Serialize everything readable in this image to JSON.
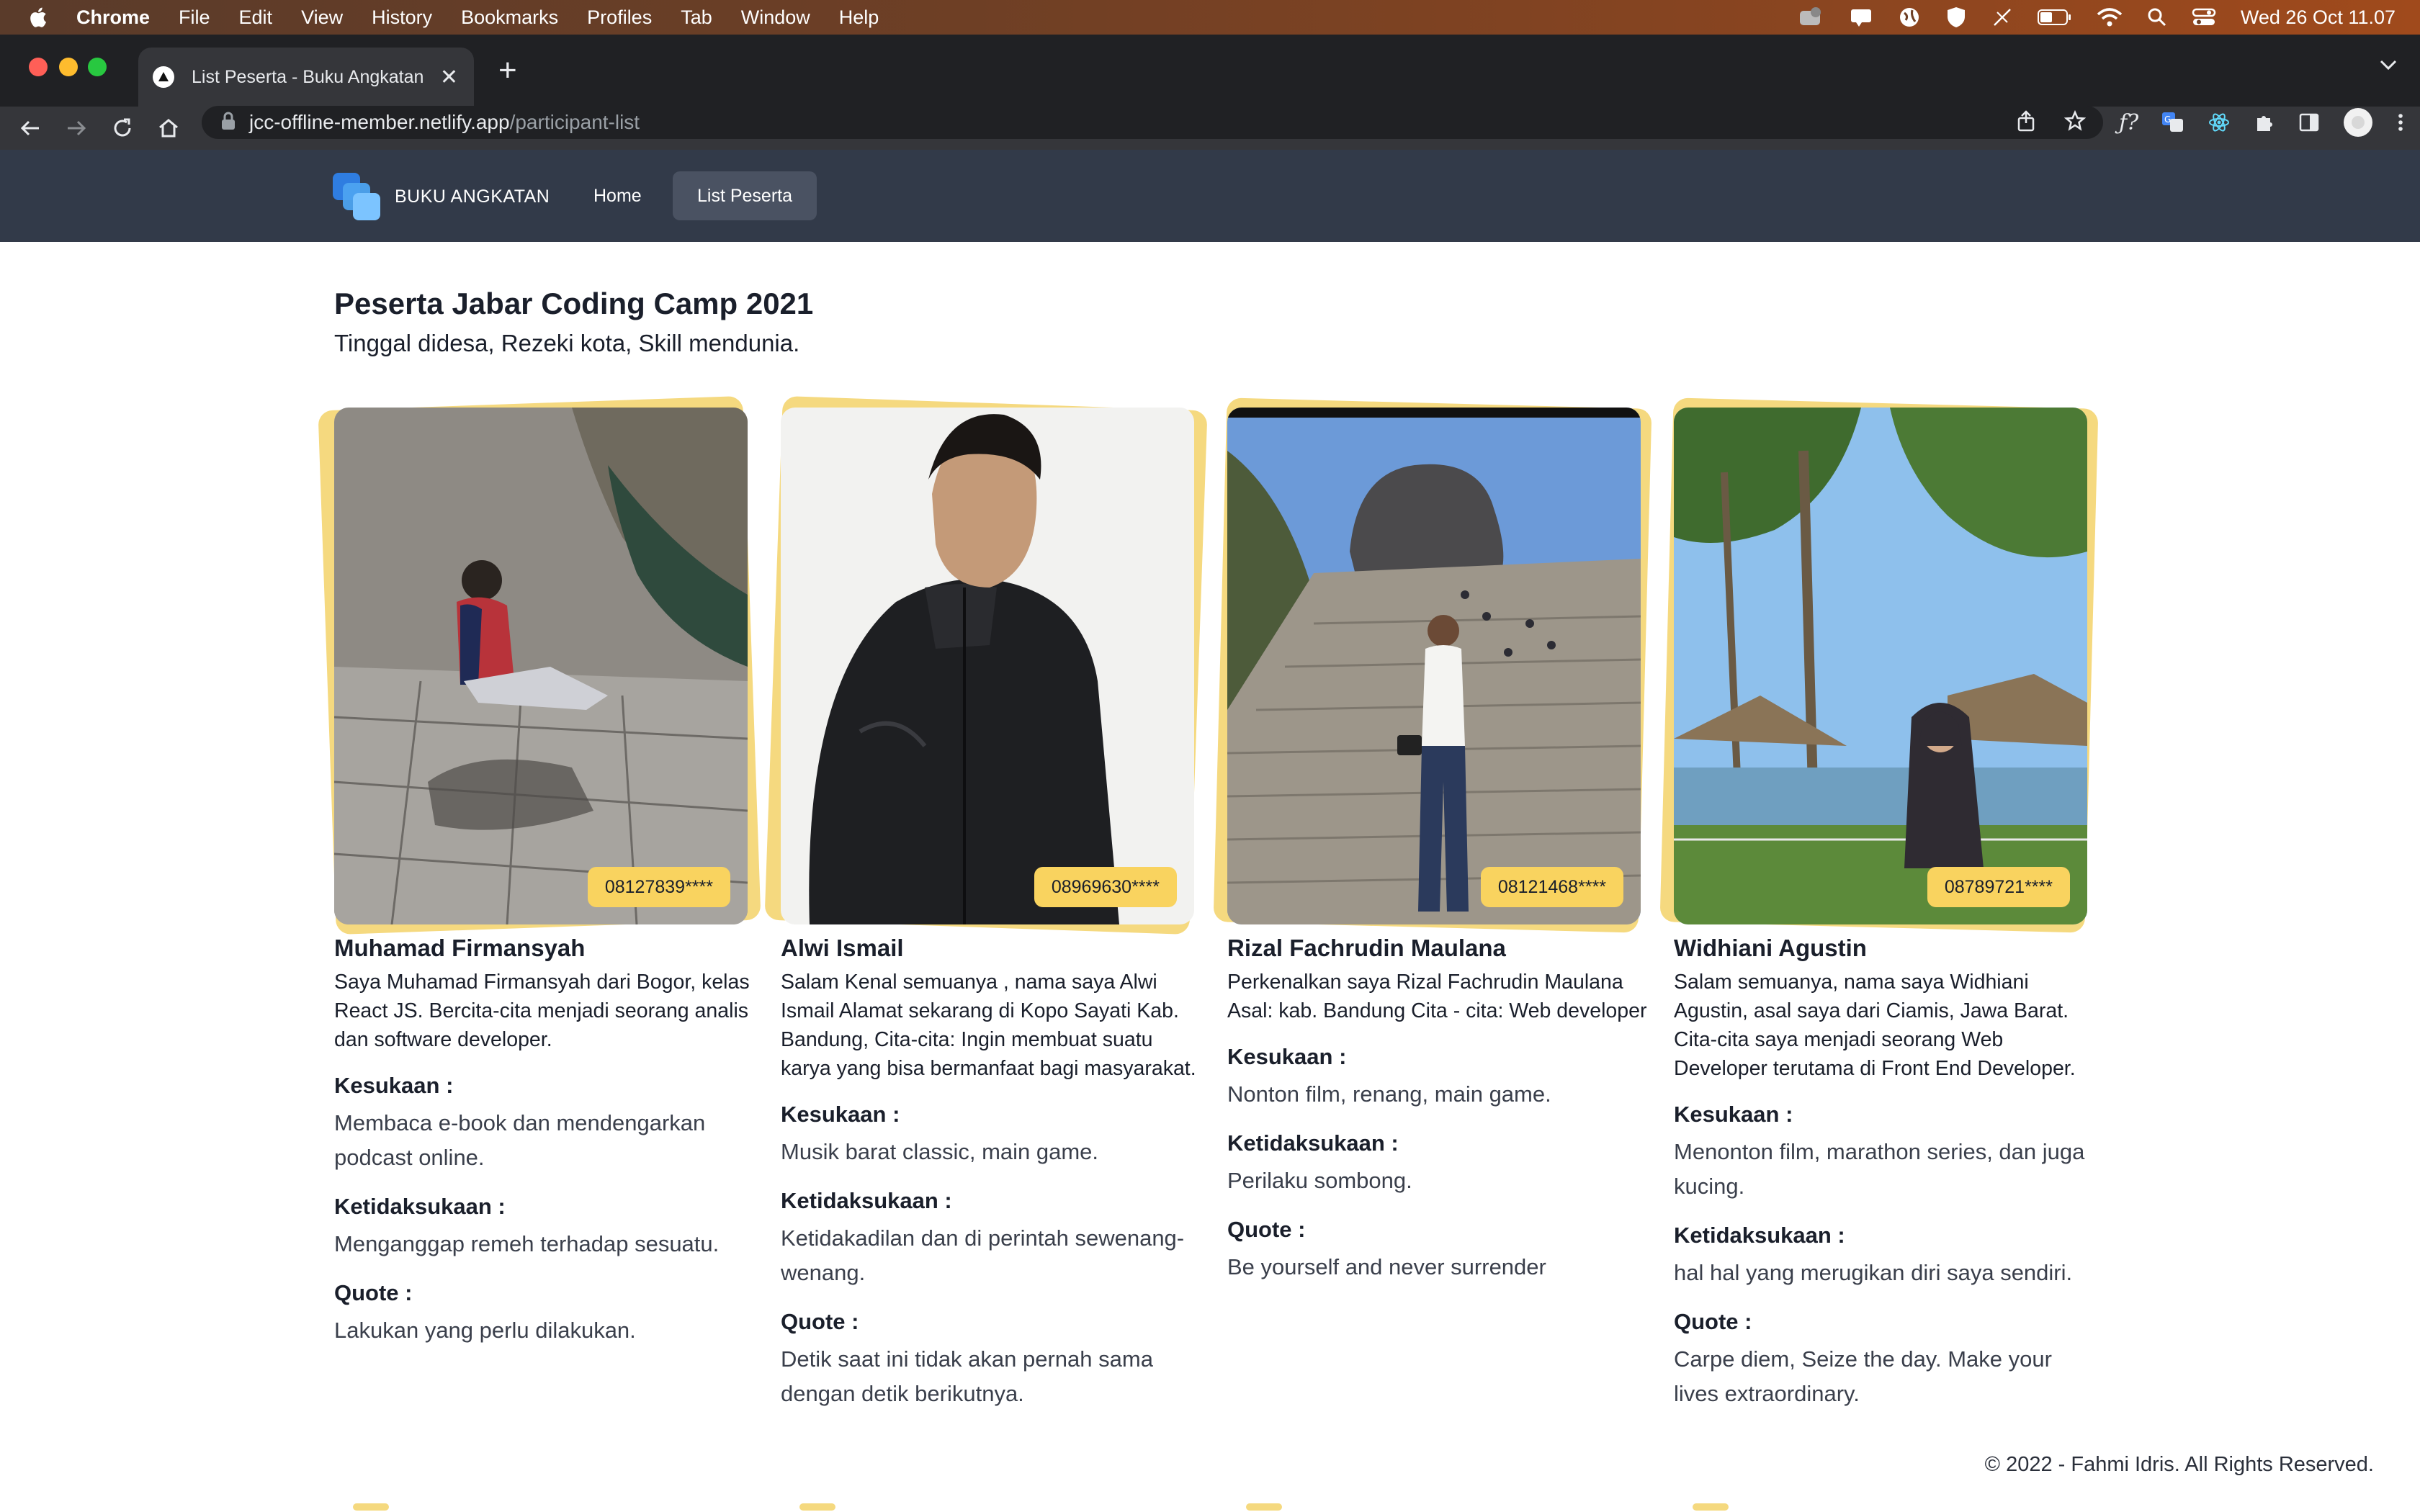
{
  "menubar": {
    "app_name": "Chrome",
    "items": [
      "File",
      "Edit",
      "View",
      "History",
      "Bookmarks",
      "Profiles",
      "Tab",
      "Window",
      "Help"
    ],
    "clock": "Wed 26 Oct  11.07"
  },
  "browser": {
    "tab_title": "List Peserta - Buku Angkatan",
    "url_host": "jcc-offline-member.netlify.app",
    "url_path": "/participant-list"
  },
  "site": {
    "brand": "BUKU ANGKATAN",
    "nav": [
      "Home",
      "List Peserta"
    ],
    "active_nav": "List Peserta",
    "title": "Peserta Jabar Coding Camp 2021",
    "subtitle": "Tinggal didesa, Rezeki kota, Skill mendunia.",
    "labels": {
      "likes": "Kesukaan :",
      "dislikes": "Ketidaksukaan :",
      "quote": "Quote :"
    },
    "footer": "© 2022 - Fahmi Idris. All Rights Reserved."
  },
  "participants": [
    {
      "name": "Muhamad Firmansyah",
      "phone": "08127839****",
      "bio": "Saya Muhamad Firmansyah dari Bogor, kelas React JS. Bercita-cita menjadi seorang analis dan software developer.",
      "likes": "Membaca e-book dan mendengarkan podcast online.",
      "dislikes": "Menganggap remeh terhadap sesuatu.",
      "quote": "Lakukan yang perlu dilakukan."
    },
    {
      "name": "Alwi Ismail",
      "phone": "08969630****",
      "bio": "Salam Kenal semuanya , nama saya Alwi Ismail Alamat sekarang di Kopo Sayati Kab. Bandung, Cita-cita: Ingin membuat suatu karya yang bisa bermanfaat bagi masyarakat.",
      "likes": "Musik barat classic, main game.",
      "dislikes": "Ketidakadilan dan di perintah sewenang-wenang.",
      "quote": "Detik saat ini tidak akan pernah sama dengan detik berikutnya."
    },
    {
      "name": "Rizal Fachrudin Maulana",
      "phone": "08121468****",
      "bio": "Perkenalkan saya Rizal Fachrudin Maulana Asal: kab. Bandung Cita - cita: Web developer",
      "likes": "Nonton film, renang, main game.",
      "dislikes": "Perilaku sombong.",
      "quote": "Be yourself and never surrender"
    },
    {
      "name": "Widhiani Agustin",
      "phone": "08789721****",
      "bio": "Salam semuanya, nama saya Widhiani Agustin, asal saya dari Ciamis, Jawa Barat. Cita-cita saya menjadi seorang Web Developer terutama di Front End Developer.",
      "likes": "Menonton film, marathon series, dan juga kucing.",
      "dislikes": "hal hal yang merugikan diri saya sendiri.",
      "quote": "Carpe diem, Seize the day. Make your lives extraordinary."
    }
  ]
}
